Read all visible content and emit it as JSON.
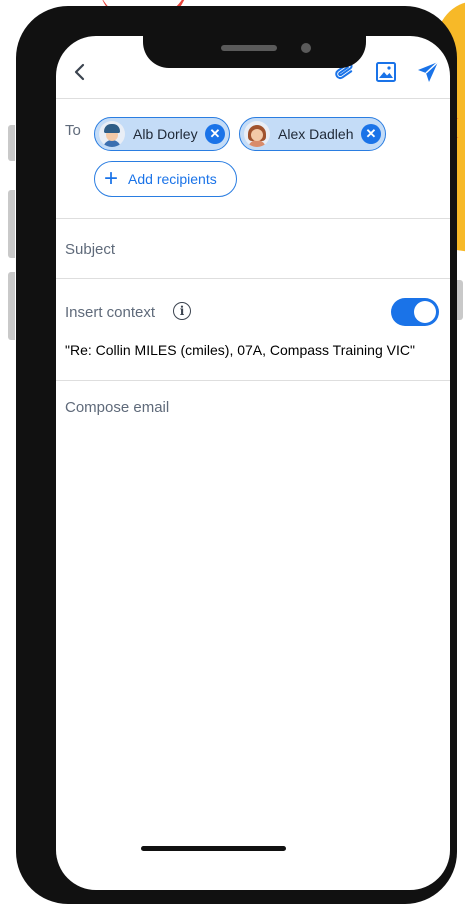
{
  "toolbar": {
    "back_icon": "chevron-left-icon",
    "attach_icon": "paperclip-icon",
    "image_icon": "image-icon",
    "send_icon": "send-icon",
    "accent": "#1a73e8"
  },
  "recipients": {
    "label": "To",
    "chips": [
      {
        "name": "Alb Dorley",
        "avatar": "avatar-male-icon"
      },
      {
        "name": "Alex Dadleh",
        "avatar": "avatar-female-icon"
      }
    ],
    "remove_icon": "close-icon",
    "add_label": "Add recipients",
    "add_icon": "plus-icon"
  },
  "subject": {
    "placeholder": "Subject"
  },
  "context": {
    "label": "Insert context",
    "info_icon": "info-icon",
    "toggle_on": true,
    "value": "\"Re: Collin MILES (cmiles), 07A, Compass Training VIC\""
  },
  "compose": {
    "placeholder": "Compose email"
  }
}
